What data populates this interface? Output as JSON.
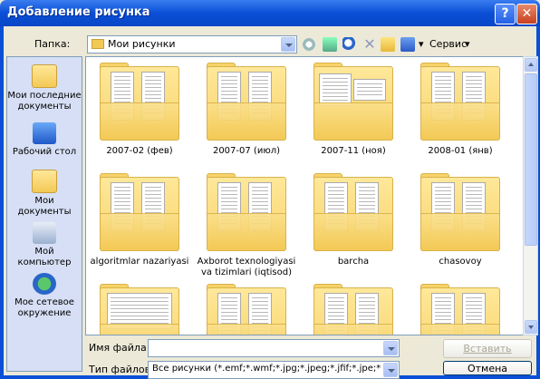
{
  "window": {
    "title": "Добавление рисунка",
    "help_glyph": "?",
    "close_glyph": "✕"
  },
  "toolbar": {
    "folder_label": "Папка:",
    "folder_value": "Мои рисунки",
    "service_label": "Сервис",
    "icons": [
      "back-icon",
      "up-folder-icon",
      "search-web-icon",
      "delete-icon",
      "new-folder-icon",
      "views-icon"
    ]
  },
  "places": [
    {
      "label": "Мои последние документы",
      "icon": "recent-documents-icon"
    },
    {
      "label": "Рабочий стол",
      "icon": "desktop-icon"
    },
    {
      "label": "Мои документы",
      "icon": "my-documents-icon"
    },
    {
      "label": "Мой компьютер",
      "icon": "my-computer-icon"
    },
    {
      "label": "Мое сетевое окружение",
      "icon": "network-icon"
    }
  ],
  "folders": [
    {
      "name": "2007-02 (фев)"
    },
    {
      "name": "2007-07 (июл)"
    },
    {
      "name": "2007-11 (ноя)"
    },
    {
      "name": "2008-01 (янв)"
    },
    {
      "name": "algoritmlar nazariyasi"
    },
    {
      "name": "Axborot texnologiyasi va tizimlari (iqtisod)"
    },
    {
      "name": "barcha"
    },
    {
      "name": "chasovoy"
    },
    {
      "name": ""
    },
    {
      "name": ""
    },
    {
      "name": ""
    },
    {
      "name": ""
    }
  ],
  "footer": {
    "filename_label": "Имя файла:",
    "filename_value": "",
    "filetype_label": "Тип файлов:",
    "filetype_value": "Все рисунки (*.emf;*.wmf;*.jpg;*.jpeg;*.jfif;*.jpe;*.png;",
    "insert_label": "Вставить",
    "cancel_label": "Отмена"
  }
}
